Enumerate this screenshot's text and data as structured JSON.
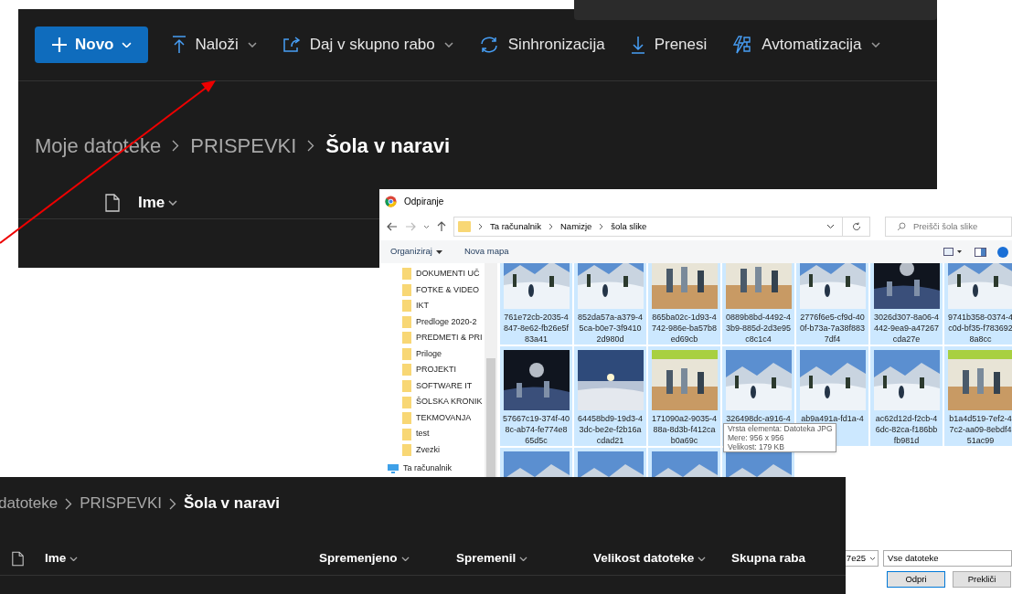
{
  "top_panel": {
    "toolbar": [
      {
        "label": "Novo",
        "kind": "primary",
        "menu": true
      },
      {
        "label": "Naloži",
        "kind": "upload",
        "menu": true
      },
      {
        "label": "Daj v skupno rabo",
        "kind": "share",
        "menu": true
      },
      {
        "label": "Sinhronizacija",
        "kind": "sync",
        "menu": false
      },
      {
        "label": "Prenesi",
        "kind": "download",
        "menu": false
      },
      {
        "label": "Avtomatizacija",
        "kind": "automate",
        "menu": true
      }
    ],
    "breadcrumb": [
      "Moje datoteke",
      "PRISPEVKI",
      "Šola v naravi"
    ],
    "column": "Ime"
  },
  "dialog": {
    "title": "Odpiranje",
    "address": [
      "Ta računalnik",
      "Namizje",
      "šola slike"
    ],
    "search_placeholder": "Preišči šola slike",
    "commands": [
      "Organiziraj",
      "Nova mapa"
    ],
    "nav": [
      {
        "label": "DOKUMENTI UČ",
        "kind": "folder"
      },
      {
        "label": "FOTKE & VIDEO",
        "kind": "folder"
      },
      {
        "label": "IKT",
        "kind": "folder"
      },
      {
        "label": "Predloge 2020-2",
        "kind": "folder"
      },
      {
        "label": "PREDMETI & PRI",
        "kind": "folder"
      },
      {
        "label": "Priloge",
        "kind": "folder"
      },
      {
        "label": "PROJEKTI",
        "kind": "folder"
      },
      {
        "label": "SOFTWARE IT",
        "kind": "folder"
      },
      {
        "label": "ŠOLSKA KRONIK",
        "kind": "folder"
      },
      {
        "label": "TEKMOVANJA",
        "kind": "folder"
      },
      {
        "label": "test",
        "kind": "folder"
      },
      {
        "label": "Zvezki",
        "kind": "folder"
      },
      {
        "label": "Ta računalnik",
        "kind": "computer"
      }
    ],
    "files": [
      {
        "lines": [
          "761e72cb-2035-4",
          "847-8e62-fb26e5f",
          "83a41"
        ],
        "selected": true
      },
      {
        "lines": [
          "852da57a-a379-4",
          "5ca-b0e7-3f9410",
          "2d980d"
        ],
        "selected": true
      },
      {
        "lines": [
          "865ba02c-1d93-4",
          "742-986e-ba57b8",
          "ed69cb"
        ],
        "selected": true
      },
      {
        "lines": [
          "0889b8bd-4492-4",
          "3b9-885d-2d3e95",
          "c8c1c4"
        ],
        "selected": true
      },
      {
        "lines": [
          "2776f6e5-cf9d-40",
          "0f-b73a-7a38f883",
          "7df4"
        ],
        "selected": true
      },
      {
        "lines": [
          "3026d307-8a06-4",
          "442-9ea9-a47267",
          "cda27e"
        ],
        "selected": true
      },
      {
        "lines": [
          "9741b358-0374-4",
          "c0d-bf35-f783692",
          "8a8cc"
        ],
        "selected": true
      },
      {
        "lines": [
          "57667c19-374f-40",
          "8c-ab74-fe774e8",
          "65d5c"
        ],
        "selected": true
      },
      {
        "lines": [
          "64458bd9-19d3-4",
          "3dc-be2e-f2b16a",
          "cdad21"
        ],
        "selected": true
      },
      {
        "lines": [
          "171090a2-9035-4",
          "88a-8d3b-f412ca",
          "b0a69c"
        ],
        "selected": true
      },
      {
        "lines": [
          "326498dc-a916-4"
        ],
        "selected": true
      },
      {
        "lines": [
          "ab9a491a-fd1a-4"
        ],
        "selected": true
      },
      {
        "lines": [
          "ac62d12d-f2cb-4",
          "6dc-82ca-f186bb",
          "fb981d"
        ],
        "selected": true
      },
      {
        "lines": [
          "b1a4d519-7ef2-4",
          "7c2-aa09-8ebdf4",
          "51ac99"
        ],
        "selected": true
      },
      {
        "selected": true
      },
      {
        "selected": true
      },
      {
        "selected": true
      },
      {
        "selected": true
      }
    ],
    "tooltip": [
      "Vrsta elementa: Datoteka JPG",
      "Mere: 956 x 956",
      "Velikost: 179 KB"
    ],
    "file_name": "7e25",
    "file_type": "Vse datoteke",
    "buttons": [
      "Odpri",
      "Prekliči"
    ]
  },
  "bottom_panel": {
    "breadcrumb": [
      "datoteke",
      "PRISPEVKI",
      "Šola v naravi"
    ],
    "columns": [
      {
        "label": "Ime",
        "sortable": true
      },
      {
        "label": "Spremenjeno",
        "sortable": true
      },
      {
        "label": "Spremenil",
        "sortable": true
      },
      {
        "label": "Velikost datoteke",
        "sortable": true
      },
      {
        "label": "Skupna raba",
        "sortable": false
      }
    ]
  }
}
